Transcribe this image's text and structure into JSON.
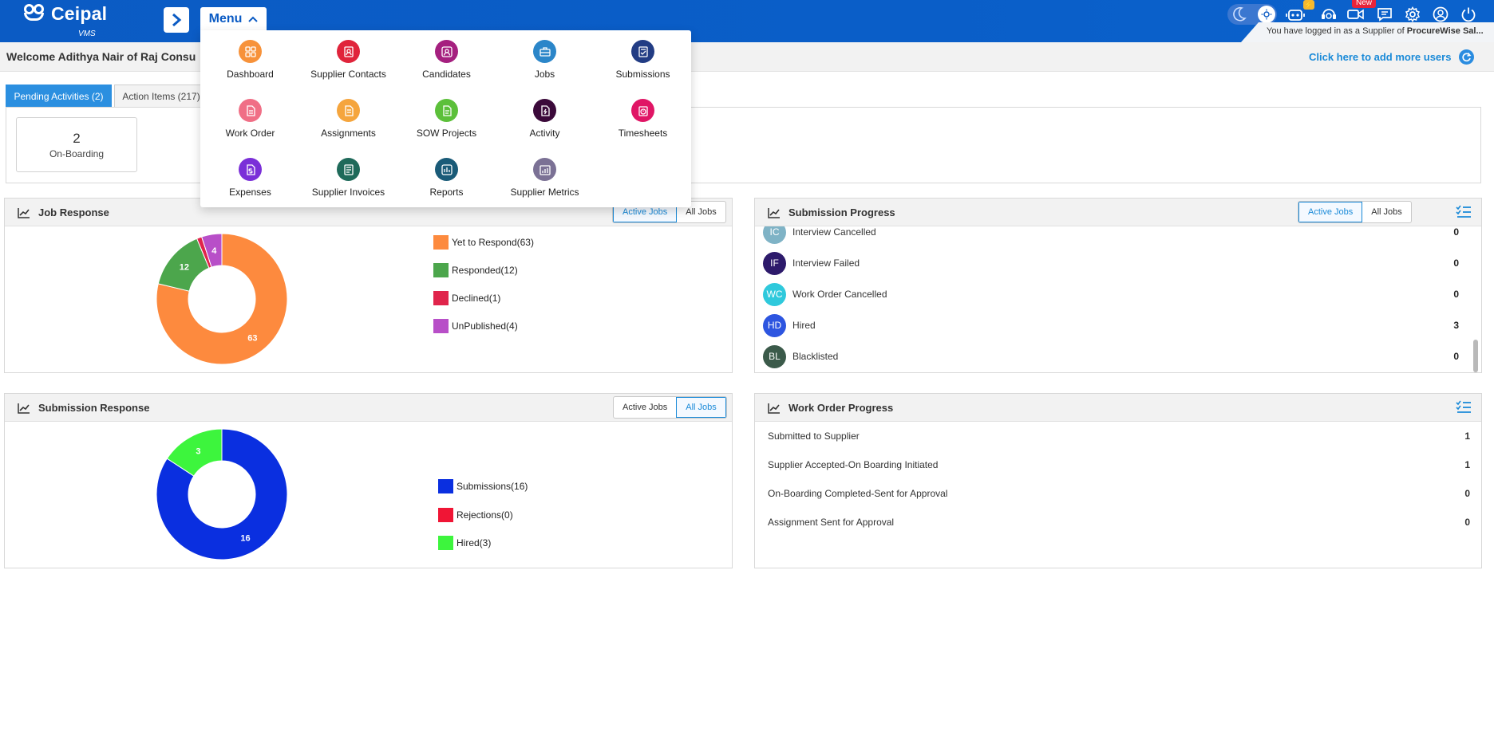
{
  "app": {
    "brand": "Ceipal",
    "sub": "VMS"
  },
  "topbar": {
    "menu_label": "Menu",
    "new_badge": "New",
    "login_prefix": "You have logged in as a Supplier of",
    "login_org": "ProcureWise Sal...",
    "icons": [
      "moon-icon",
      "sun-icon",
      "bot-icon",
      "support-icon",
      "video-icon",
      "chat-icon",
      "settings-icon",
      "user-icon",
      "power-icon"
    ]
  },
  "welcome": {
    "text": "Welcome Adithya Nair of Raj Consu",
    "add_users": "Click here to add more users"
  },
  "tabs": [
    {
      "label": "Pending Activities (2)",
      "active": true
    },
    {
      "label": "Action Items (217)",
      "active": false
    }
  ],
  "activities": [
    {
      "count": "2",
      "label": "On-Boarding"
    }
  ],
  "menu_items": [
    {
      "label": "Dashboard",
      "icon": "dashboard-icon",
      "color": "#f7923a"
    },
    {
      "label": "Supplier Contacts",
      "icon": "contacts-icon",
      "color": "#e0243b"
    },
    {
      "label": "Candidates",
      "icon": "candidates-icon",
      "color": "#a5207f"
    },
    {
      "label": "Jobs",
      "icon": "jobs-icon",
      "color": "#2b86c9"
    },
    {
      "label": "Submissions",
      "icon": "submissions-icon",
      "color": "#223c84"
    },
    {
      "label": "Work Order",
      "icon": "work-order-icon",
      "color": "#f06f86"
    },
    {
      "label": "Assignments",
      "icon": "assignments-icon",
      "color": "#f5a53d"
    },
    {
      "label": "SOW Projects",
      "icon": "sow-projects-icon",
      "color": "#5cc03a"
    },
    {
      "label": "Activity",
      "icon": "activity-icon",
      "color": "#3b0a3a"
    },
    {
      "label": "Timesheets",
      "icon": "timesheets-icon",
      "color": "#e01565"
    },
    {
      "label": "Expenses",
      "icon": "expenses-icon",
      "color": "#7a2fd8"
    },
    {
      "label": "Supplier Invoices",
      "icon": "invoices-icon",
      "color": "#1f6a5a"
    },
    {
      "label": "Reports",
      "icon": "reports-icon",
      "color": "#1a5b78"
    },
    {
      "label": "Supplier Metrics",
      "icon": "metrics-icon",
      "color": "#7b7195"
    }
  ],
  "job_response": {
    "title": "Job Response",
    "toggle": [
      "Active Jobs",
      "All Jobs"
    ],
    "active_toggle": "Active Jobs",
    "legend": [
      "Yet to Respond(63)",
      "Responded(12)",
      "Declined(1)",
      "UnPublished(4)"
    ]
  },
  "submission_response": {
    "title": "Submission Response",
    "toggle": [
      "Active Jobs",
      "All Jobs"
    ],
    "active_toggle": "All Jobs",
    "legend": [
      "Submissions(16)",
      "Rejections(0)",
      "Hired(3)"
    ]
  },
  "submission_progress": {
    "title": "Submission Progress",
    "toggle": [
      "Active Jobs",
      "All Jobs"
    ],
    "active_toggle": "Active Jobs",
    "rows": [
      {
        "initials": "IC",
        "label": "Interview Cancelled",
        "count": "0",
        "color": "#7fb3c6"
      },
      {
        "initials": "IF",
        "label": "Interview Failed",
        "count": "0",
        "color": "#2d1a6b"
      },
      {
        "initials": "WC",
        "label": "Work Order Cancelled",
        "count": "0",
        "color": "#2fc9dc"
      },
      {
        "initials": "HD",
        "label": "Hired",
        "count": "3",
        "color": "#2d55e0"
      },
      {
        "initials": "BL",
        "label": "Blacklisted",
        "count": "0",
        "color": "#3b5a4a"
      }
    ]
  },
  "work_order_progress": {
    "title": "Work Order Progress",
    "rows": [
      {
        "label": "Submitted to Supplier",
        "count": "1"
      },
      {
        "label": "Supplier Accepted-On Boarding Initiated",
        "count": "1"
      },
      {
        "label": "On-Boarding Completed-Sent for Approval",
        "count": "0"
      },
      {
        "label": "Assignment Sent for Approval",
        "count": "0"
      }
    ]
  },
  "chart_data": [
    {
      "type": "pie",
      "title": "Job Response",
      "categories": [
        "Yet to Respond",
        "Responded",
        "Declined",
        "UnPublished"
      ],
      "values": [
        63,
        12,
        1,
        4
      ],
      "colors": [
        "#fd8a3e",
        "#4ca64c",
        "#e0244b",
        "#b84fc8"
      ],
      "legend_position": "right"
    },
    {
      "type": "pie",
      "title": "Submission Response",
      "categories": [
        "Submissions",
        "Rejections",
        "Hired"
      ],
      "values": [
        16,
        0,
        3
      ],
      "colors": [
        "#0a2fe0",
        "#f01535",
        "#3df53d"
      ],
      "legend_position": "right"
    }
  ]
}
